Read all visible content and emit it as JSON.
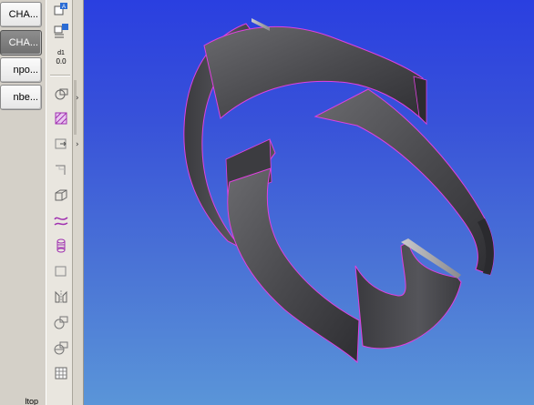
{
  "left_panel": {
    "buttons": [
      {
        "label": "CHA...",
        "active": false
      },
      {
        "label": "CHA...",
        "active": true
      },
      {
        "label": "npo...",
        "active": false
      },
      {
        "label": "nbe...",
        "active": false
      }
    ],
    "bottom_text": "ltop"
  },
  "toolstrip": {
    "value_readout": "0.0",
    "value_prefix": "d1",
    "tools": [
      "sketch-view-icon",
      "sketch-annotation-icon",
      "dimension-value-icon",
      "plane-sketch-icon",
      "hatch-icon",
      "extrude-icon",
      "corner-icon",
      "box-icon",
      "curve-icon",
      "cylinder-icon",
      "rectangle-icon",
      "mirror-icon",
      "view-projection-icon",
      "view-projection-2-icon",
      "grid-icon"
    ]
  },
  "viewport": {
    "background_top": "#2a3fe0",
    "background_bottom": "#5a95d8",
    "model_color": "#4a4a4c",
    "edge_highlight": "#e040e0"
  }
}
